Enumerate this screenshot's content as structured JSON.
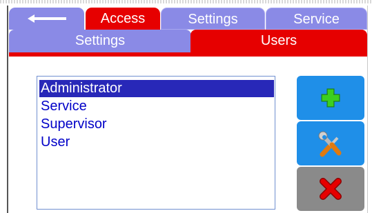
{
  "top_tabs": {
    "back_icon": "back-arrow-icon",
    "access": "Access",
    "settings": "Settings",
    "service": "Service"
  },
  "sub_tabs": {
    "settings": "Settings",
    "users": "Users"
  },
  "users": {
    "items": [
      "Administrator",
      "Service",
      "Supervisor",
      "User"
    ],
    "selected_index": 0
  },
  "actions": {
    "add_icon": "plus-icon",
    "edit_icon": "tools-icon",
    "delete_icon": "x-icon"
  },
  "colors": {
    "tab_inactive": "#8a8ae6",
    "tab_active": "#e60000",
    "button_blue": "#1f8fe8",
    "button_gray": "#8a8a8a",
    "selection": "#2828b8"
  }
}
